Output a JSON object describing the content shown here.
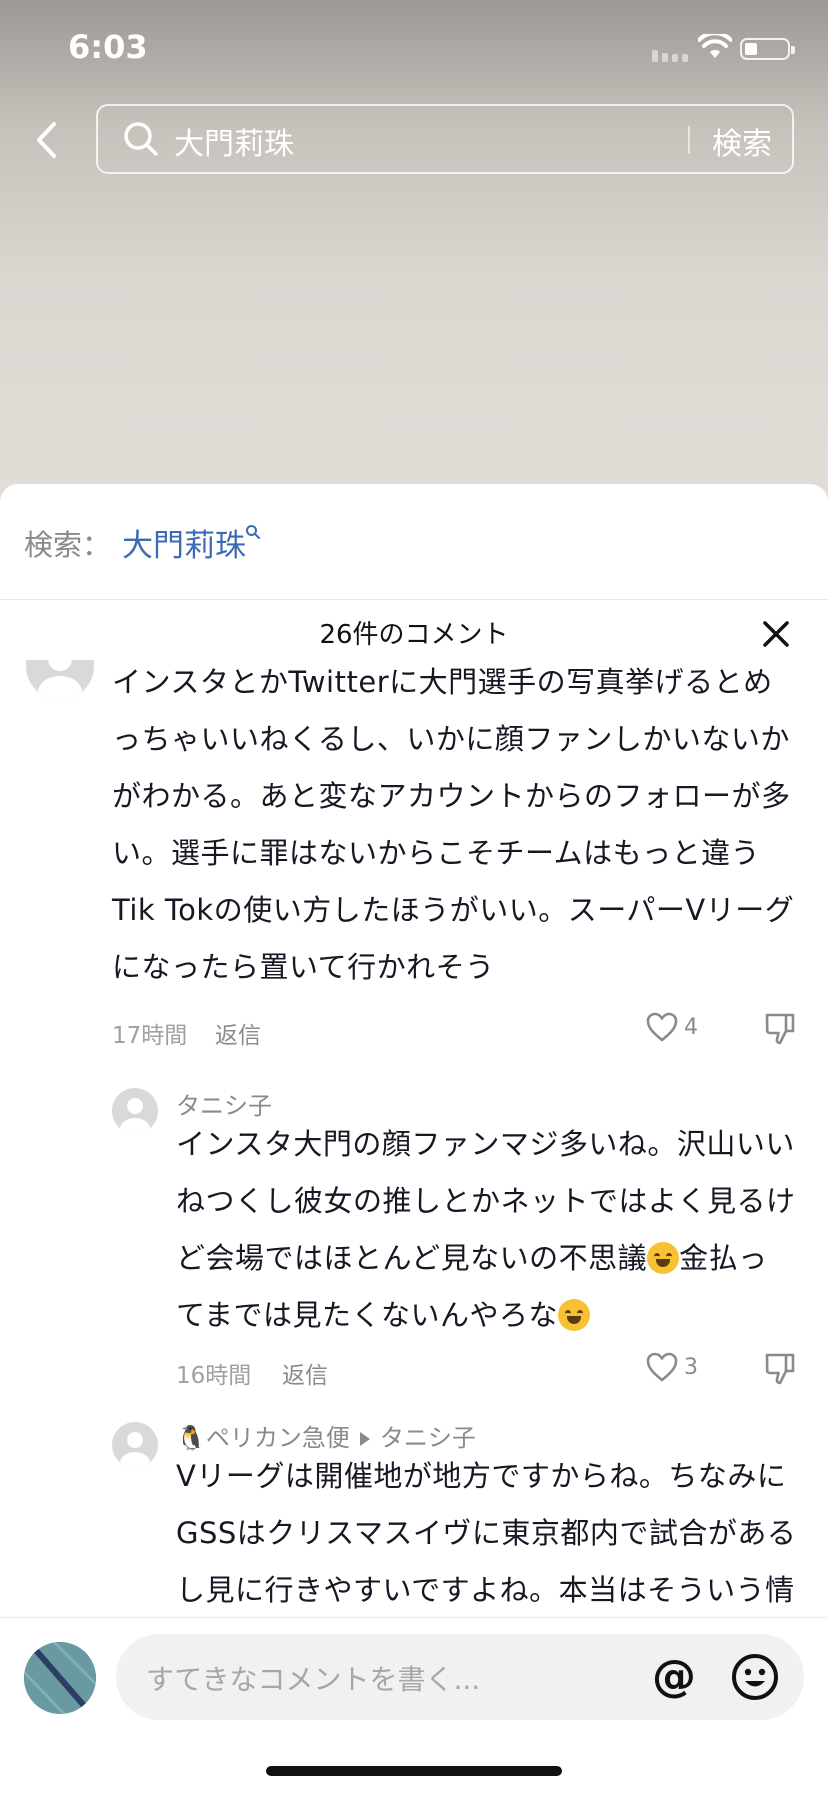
{
  "status": {
    "time": "6:03"
  },
  "search": {
    "query": "大門莉珠",
    "submit_label": "検索"
  },
  "related_search": {
    "label": "検索：",
    "link": "大門莉珠"
  },
  "comments_header": {
    "count_label": "26件のコメント"
  },
  "comments": [
    {
      "lines": [
        "インスタとかTwitterに大門選手の写真挙げるとめ",
        "っちゃいいねくるし、いかに顔ファンしかいないか",
        "がわかる。あと変なアカウントからのフォローが多",
        "い。選手に罪はないからこそチームはもっと違う",
        "Tik Tokの使い方したほうがいい。スーパーVリーグ",
        "になったら置いて行かれそう"
      ],
      "time": "17時間",
      "reply_label": "返信",
      "likes": "4"
    },
    {
      "username": "タニシ子",
      "lines": [
        "インスタ大門の顔ファンマジ多いね。沢山いい",
        "ねつくし彼女の推しとかネットではよく見るけ",
        "ど会場ではほとんど見ないの不思議",
        "てまでは見たくないんやろな"
      ],
      "line3_tail": "金払っ",
      "time": "16時間",
      "reply_label": "返信",
      "likes": "3"
    },
    {
      "username": "🐧ペリカン急便",
      "reply_to": "タニシ子",
      "lines": [
        "Vリーグは開催地が地方ですからね。ちなみに",
        "GSSはクリスマスイヴに東京都内で試合がある",
        "し見に行きやすいですよね。本当はそういう情"
      ]
    }
  ],
  "input": {
    "placeholder": "すてきなコメントを書く...",
    "at_symbol": "@"
  }
}
